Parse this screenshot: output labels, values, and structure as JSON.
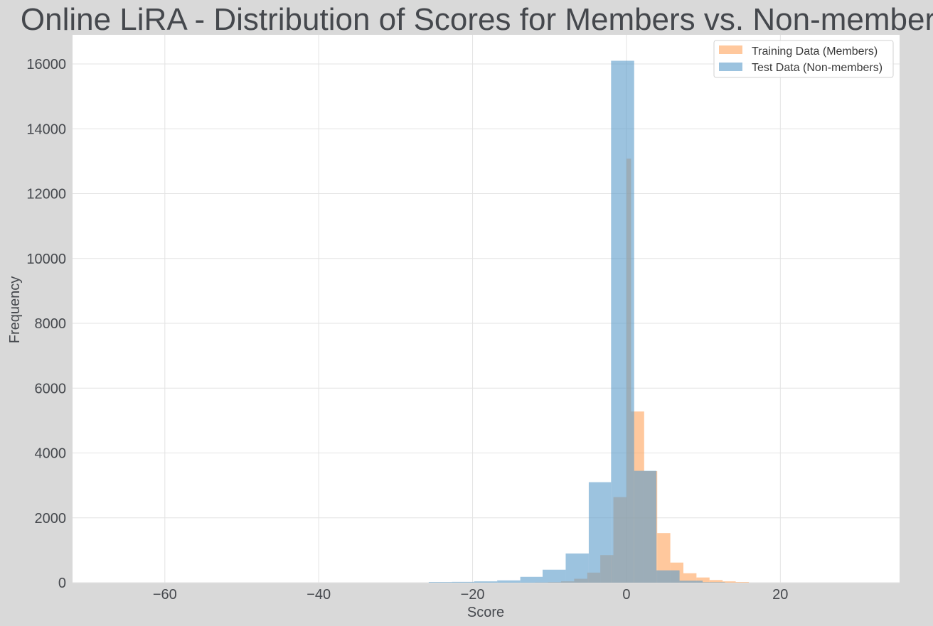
{
  "chart_data": {
    "type": "bar",
    "title": "Online LiRA - Distribution of Scores for Members vs. Non-members",
    "xlabel": "Score",
    "ylabel": "Frequency",
    "xlim": [
      -72,
      35.5
    ],
    "ylim": [
      0,
      16900
    ],
    "xticks": [
      -60,
      -40,
      -20,
      0,
      20
    ],
    "xtick_labels": [
      "−60",
      "−40",
      "−20",
      "0",
      "20"
    ],
    "yticks": [
      0,
      2000,
      4000,
      6000,
      8000,
      10000,
      12000,
      14000,
      16000
    ],
    "ytick_labels": [
      "0",
      "2000",
      "4000",
      "6000",
      "8000",
      "10000",
      "12000",
      "14000",
      "16000"
    ],
    "grid": true,
    "legend_position": "top-right",
    "series": [
      {
        "name": "Training Data (Members)",
        "color": "#ffa45c",
        "opacity": 0.6,
        "bins": [
          [
            -11.9,
            -10.2,
            5
          ],
          [
            -10.2,
            -8.5,
            15
          ],
          [
            -8.5,
            -6.8,
            40
          ],
          [
            -6.8,
            -5.1,
            120
          ],
          [
            -5.1,
            -3.4,
            310
          ],
          [
            -3.4,
            -1.7,
            850
          ],
          [
            -1.7,
            0.0,
            2640
          ],
          [
            0.0,
            0.6,
            13080
          ],
          [
            0.6,
            2.3,
            5280
          ],
          [
            2.3,
            4.0,
            3440
          ],
          [
            4.0,
            5.7,
            1530
          ],
          [
            5.7,
            7.4,
            620
          ],
          [
            7.4,
            9.1,
            290
          ],
          [
            9.1,
            10.8,
            160
          ],
          [
            10.8,
            12.5,
            80
          ],
          [
            12.5,
            14.2,
            40
          ],
          [
            14.2,
            15.9,
            20
          ]
        ]
      },
      {
        "name": "Test Data (Non-members)",
        "color": "#5a9bc9",
        "opacity": 0.6,
        "bins": [
          [
            -25.7,
            -22.7,
            20
          ],
          [
            -22.7,
            -19.8,
            25
          ],
          [
            -19.8,
            -16.8,
            40
          ],
          [
            -16.8,
            -13.8,
            70
          ],
          [
            -13.8,
            -10.9,
            180
          ],
          [
            -10.9,
            -7.9,
            400
          ],
          [
            -7.9,
            -4.9,
            900
          ],
          [
            -4.9,
            -2.0,
            3100
          ],
          [
            -2.0,
            1.0,
            16100
          ],
          [
            1.0,
            3.9,
            3450
          ],
          [
            3.9,
            6.9,
            380
          ],
          [
            6.9,
            9.9,
            60
          ],
          [
            9.9,
            12.8,
            15
          ]
        ]
      }
    ]
  }
}
